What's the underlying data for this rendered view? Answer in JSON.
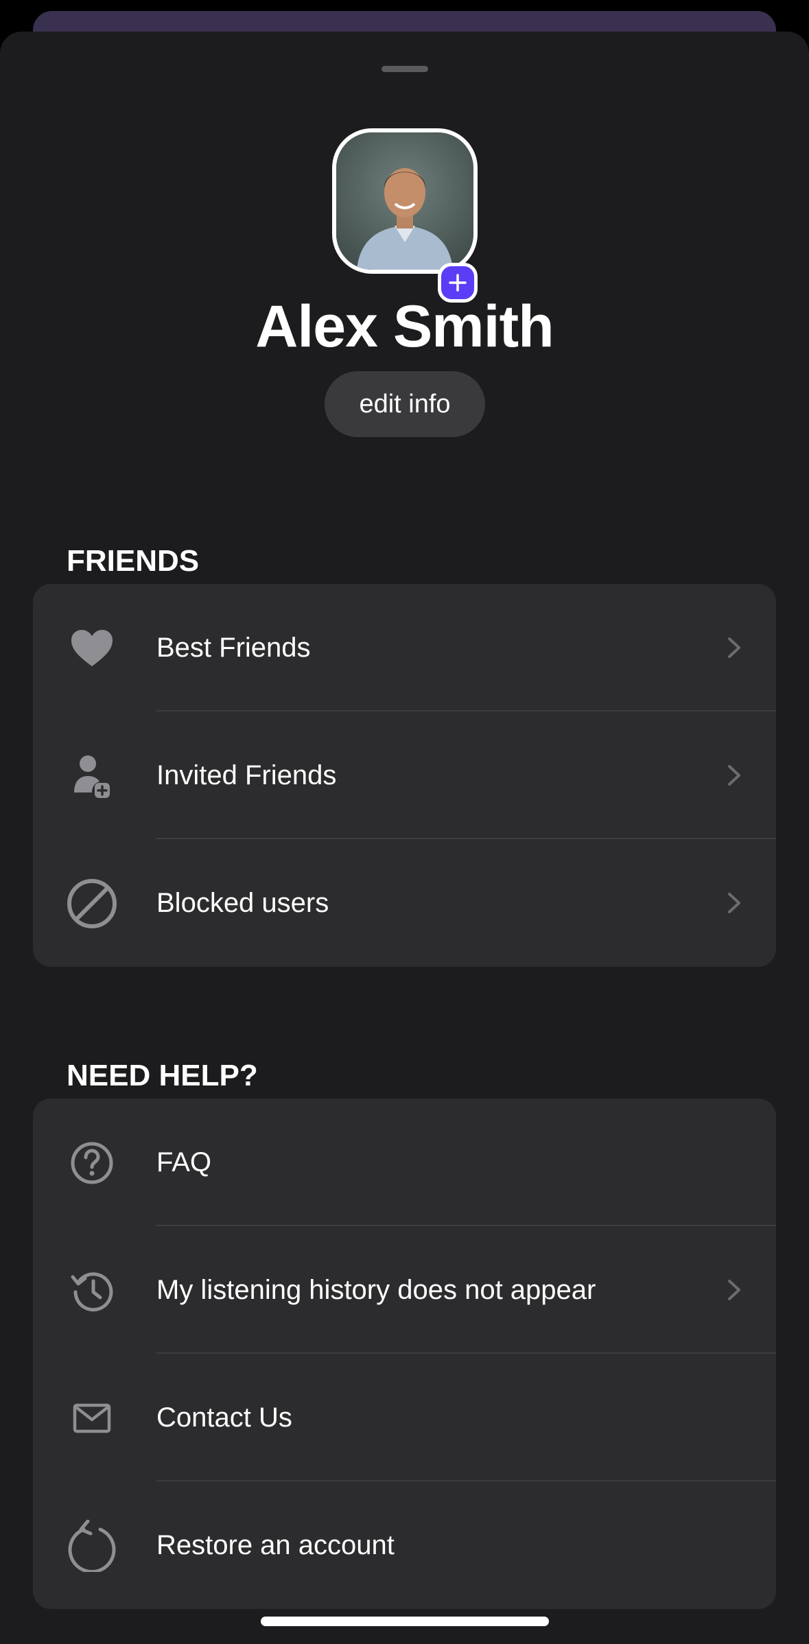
{
  "profile": {
    "name": "Alex Smith",
    "edit_label": "edit info",
    "add_photo_icon": "plus-icon"
  },
  "friends_section": {
    "title": "FRIENDS",
    "items": [
      {
        "label": "Best Friends",
        "icon": "heart-icon",
        "has_chevron": true
      },
      {
        "label": "Invited Friends",
        "icon": "person-add-icon",
        "has_chevron": true
      },
      {
        "label": "Blocked users",
        "icon": "blocked-icon",
        "has_chevron": true
      }
    ]
  },
  "help_section": {
    "title": "NEED HELP?",
    "items": [
      {
        "label": "FAQ",
        "icon": "question-circle-icon",
        "has_chevron": false
      },
      {
        "label": "My listening history does not appear",
        "icon": "history-icon",
        "has_chevron": true
      },
      {
        "label": "Contact Us",
        "icon": "mail-icon",
        "has_chevron": false
      },
      {
        "label": "Restore an account",
        "icon": "restore-icon",
        "has_chevron": false
      }
    ]
  },
  "colors": {
    "accent": "#5b3df5",
    "sheet_background": "#1c1c1e",
    "card_background": "#2c2c2e",
    "icon_gray": "#8e8e93"
  }
}
